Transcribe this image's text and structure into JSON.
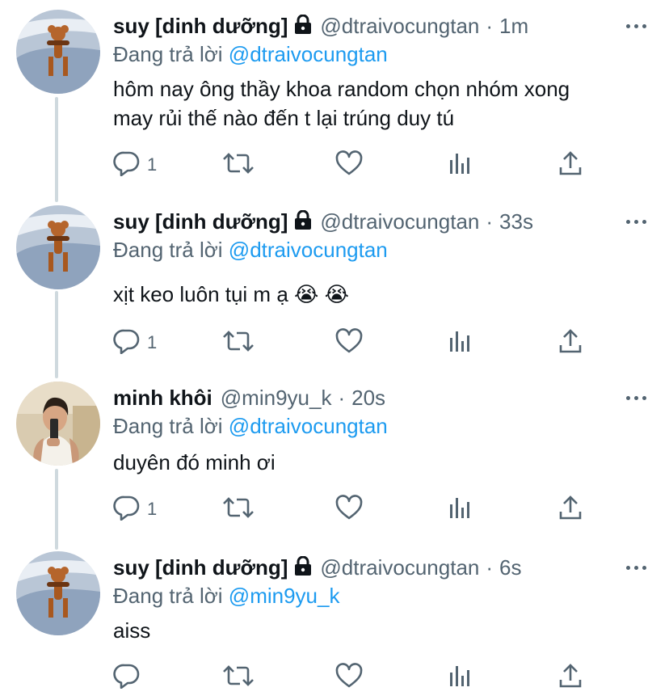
{
  "tweets": [
    {
      "name": "suy [dinh dưỡng]",
      "handle": "@dtraivocungtan",
      "separator": "·",
      "time": "1m",
      "replying_prefix": "Đang trả lời",
      "replying_to": "@dtraivocungtan",
      "text_line1": "hôm nay ông thầy khoa random chọn nhóm xong",
      "text_line2": "may rủi thế nào đến t lại trúng duy tú",
      "reply_count": "1",
      "locked": true,
      "avatar": "jerry-mouse"
    },
    {
      "name": "suy [dinh dưỡng]",
      "handle": "@dtraivocungtan",
      "separator": "·",
      "time": "33s",
      "replying_prefix": "Đang trả lời",
      "replying_to": "@dtraivocungtan",
      "text_line1": "xịt keo luôn tụi m ạ 😭 😭",
      "text_line2": "",
      "reply_count": "1",
      "locked": true,
      "avatar": "jerry-mouse"
    },
    {
      "name": "minh khôi",
      "handle": "@min9yu_k",
      "separator": "·",
      "time": "20s",
      "replying_prefix": "Đang trả lời",
      "replying_to": "@dtraivocungtan",
      "text_line1": "duyên đó minh ơi",
      "text_line2": "",
      "reply_count": "1",
      "locked": false,
      "avatar": "person-selfie"
    },
    {
      "name": "suy [dinh dưỡng]",
      "handle": "@dtraivocungtan",
      "separator": "·",
      "time": "6s",
      "replying_prefix": "Đang trả lời",
      "replying_to": "@min9yu_k",
      "text_line1": "aiss",
      "text_line2": "",
      "reply_count": "",
      "locked": true,
      "avatar": "jerry-mouse"
    }
  ],
  "icons": {
    "reply": "reply-icon",
    "retweet": "retweet-icon",
    "like": "like-icon",
    "analytics": "analytics-icon",
    "share": "share-icon",
    "more": "more-icon",
    "lock": "lock-icon"
  },
  "colors": {
    "accent": "#1d9bf0",
    "secondary_text": "#536471",
    "thread_line": "#cfd9de"
  }
}
